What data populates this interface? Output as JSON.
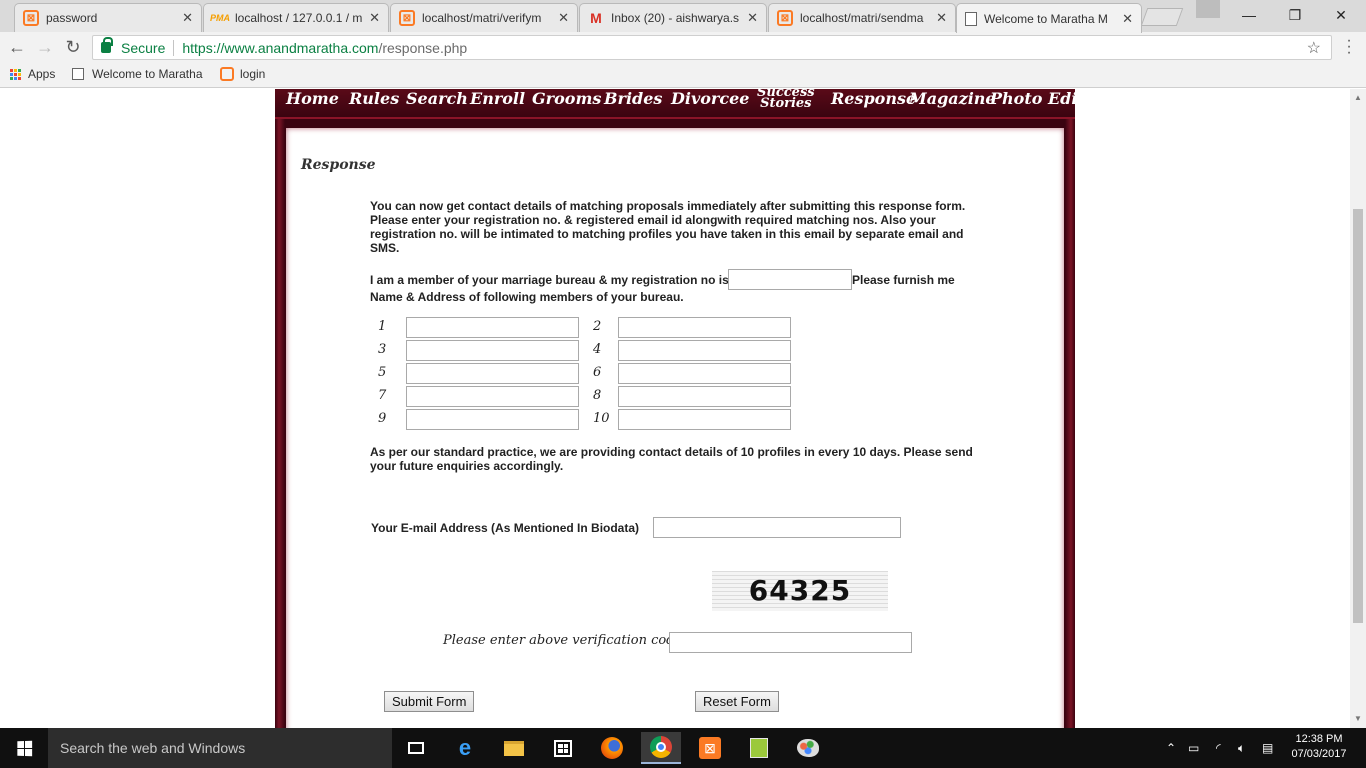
{
  "browser": {
    "tabs": [
      {
        "title": "password",
        "favicon": "xampp-icon"
      },
      {
        "title": "localhost / 127.0.0.1 / m",
        "favicon": "phpmyadmin-icon"
      },
      {
        "title": "localhost/matri/verifym",
        "favicon": "xampp-icon"
      },
      {
        "title": "Inbox (20) - aishwarya.s",
        "favicon": "gmail-icon"
      },
      {
        "title": "localhost/matri/sendma",
        "favicon": "xampp-icon"
      },
      {
        "title": "Welcome to Maratha M",
        "favicon": "document-icon",
        "active": true
      }
    ],
    "omnibox": {
      "secure_label": "Secure",
      "url_host": "https://www.anandmaratha.com",
      "url_path": "/response.php"
    },
    "bookmarks": [
      {
        "label": "Apps",
        "icon": "apps-grid-icon"
      },
      {
        "label": "Welcome to Maratha",
        "icon": "document-icon"
      },
      {
        "label": "login",
        "icon": "xampp-icon"
      }
    ],
    "colors": {
      "secure": "#0b8043",
      "xampp": "#fb7a24"
    }
  },
  "site": {
    "nav": [
      {
        "label": "Home"
      },
      {
        "label": "Rules"
      },
      {
        "label": "Search"
      },
      {
        "label": "Enroll"
      },
      {
        "label": "Grooms"
      },
      {
        "label": "Brides"
      },
      {
        "label": "Divorcee"
      },
      {
        "label_line1": "Success",
        "label_line2": "Stories"
      },
      {
        "label": "Response"
      },
      {
        "label": "Magazine"
      },
      {
        "label": "Photo Edit"
      }
    ],
    "colors": {
      "maroon": "#5a0a18",
      "frame": "#3a0310"
    },
    "heading": "Response",
    "intro": "You can now get contact details of matching proposals immediately after submitting this response form. Please enter your registration no. & registered email id alongwith required matching nos. Also your registration no. will be intimated to matching profiles you have taken in this email by separate email and SMS.",
    "member_line_start": "I am a member of your marriage bureau & my registration no is",
    "member_line_end": "Please furnish me",
    "member_line_2": "Name & Address of following members of your bureau.",
    "registration_value": "",
    "profile_numbers": [
      "1",
      "2",
      "3",
      "4",
      "5",
      "6",
      "7",
      "8",
      "9",
      "10"
    ],
    "profile_values": [
      "",
      "",
      "",
      "",
      "",
      "",
      "",
      "",
      "",
      ""
    ],
    "practice_note": "As per our standard practice, we are providing contact details of 10 profiles in every 10 days. Please send your future enquiries accordingly.",
    "email_label": "Your E-mail Address (As Mentioned In Biodata)",
    "email_value": "",
    "captcha_text": "64325",
    "verify_label": "Please enter above verification code",
    "verify_value": "",
    "submit_label": "Submit Form",
    "reset_label": "Reset Form"
  },
  "taskbar": {
    "search_placeholder": "Search the web and Windows",
    "pinned": [
      "task-view-icon",
      "edge-icon",
      "file-explorer-icon",
      "store-icon",
      "firefox-icon",
      "chrome-icon",
      "xampp-icon",
      "notepad-icon",
      "paint-icon"
    ],
    "time": "12:38 PM",
    "date": "07/03/2017"
  }
}
